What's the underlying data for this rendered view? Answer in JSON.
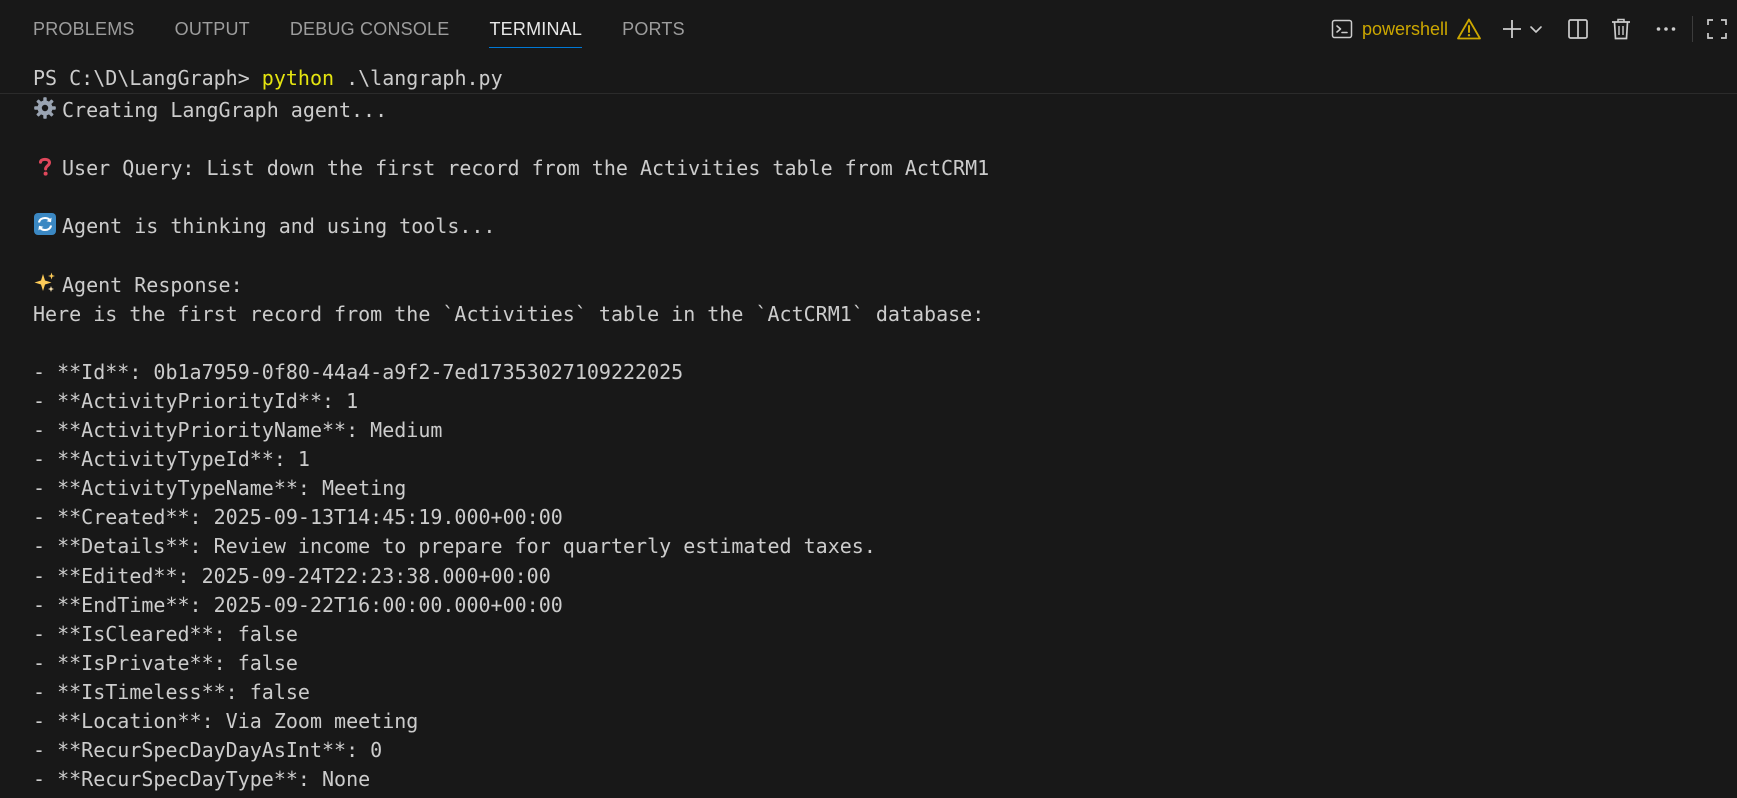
{
  "panel": {
    "tabs": [
      {
        "label": "PROBLEMS",
        "active": false
      },
      {
        "label": "OUTPUT",
        "active": false
      },
      {
        "label": "DEBUG CONSOLE",
        "active": false
      },
      {
        "label": "TERMINAL",
        "active": true
      },
      {
        "label": "PORTS",
        "active": false
      }
    ],
    "toolbar": {
      "shell_icon": "terminal-powershell-icon",
      "shell_label": "powershell",
      "warning_icon": "warning-icon",
      "new_terminal_icon": "plus-icon",
      "dropdown_icon": "chevron-down-icon",
      "split_icon": "split-terminal-icon",
      "kill_icon": "trash-icon",
      "more_icon": "ellipsis-icon",
      "maximize_icon": "maximize-icon"
    },
    "colors": {
      "accent": "#0078d4",
      "warning": "#cca700",
      "command": "#e5e510",
      "background": "#181818",
      "text": "#cccccc"
    }
  },
  "terminal": {
    "prompt": "PS C:\\D\\LangGraph> ",
    "command_exe": "python",
    "command_args": " .\\langraph.py",
    "lines": [
      {
        "icon": "gear-icon",
        "text": "Creating LangGraph agent..."
      },
      {
        "icon": "",
        "text": ""
      },
      {
        "icon": "question-icon",
        "text": "User Query: List down the first record from the Activities table from ActCRM1"
      },
      {
        "icon": "",
        "text": ""
      },
      {
        "icon": "repeat-icon",
        "text": "Agent is thinking and using tools..."
      },
      {
        "icon": "",
        "text": ""
      },
      {
        "icon": "sparkles-icon",
        "text": "Agent Response:"
      },
      {
        "icon": "",
        "text": "Here is the first record from the `Activities` table in the `ActCRM1` database:"
      },
      {
        "icon": "",
        "text": ""
      },
      {
        "icon": "",
        "text": "- **Id**: 0b1a7959-0f80-44a4-a9f2-7ed17353027109222025"
      },
      {
        "icon": "",
        "text": "- **ActivityPriorityId**: 1"
      },
      {
        "icon": "",
        "text": "- **ActivityPriorityName**: Medium"
      },
      {
        "icon": "",
        "text": "- **ActivityTypeId**: 1"
      },
      {
        "icon": "",
        "text": "- **ActivityTypeName**: Meeting"
      },
      {
        "icon": "",
        "text": "- **Created**: 2025-09-13T14:45:19.000+00:00"
      },
      {
        "icon": "",
        "text": "- **Details**: Review income to prepare for quarterly estimated taxes."
      },
      {
        "icon": "",
        "text": "- **Edited**: 2025-09-24T22:23:38.000+00:00"
      },
      {
        "icon": "",
        "text": "- **EndTime**: 2025-09-22T16:00:00.000+00:00"
      },
      {
        "icon": "",
        "text": "- **IsCleared**: false"
      },
      {
        "icon": "",
        "text": "- **IsPrivate**: false"
      },
      {
        "icon": "",
        "text": "- **IsTimeless**: false"
      },
      {
        "icon": "",
        "text": "- **Location**: Via Zoom meeting"
      },
      {
        "icon": "",
        "text": "- **RecurSpecDayDayAsInt**: 0"
      },
      {
        "icon": "",
        "text": "- **RecurSpecDayType**: None"
      }
    ]
  }
}
